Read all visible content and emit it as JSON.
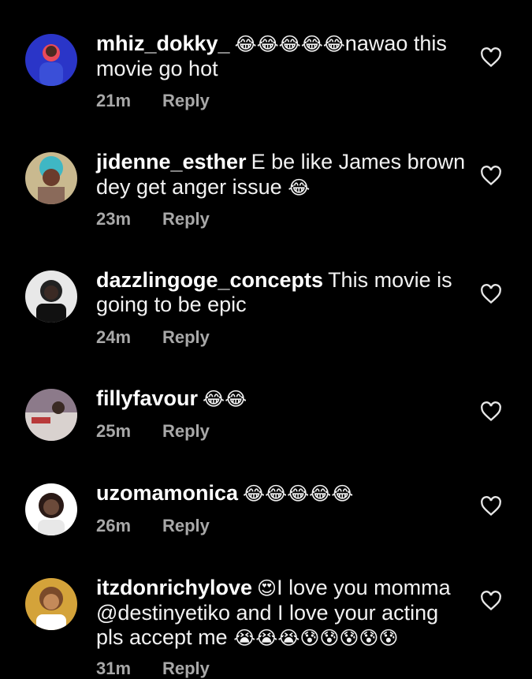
{
  "comments": [
    {
      "username": "mhiz_dokky_",
      "emoji_prefix": "😂😂😂😂😂",
      "text": "nawao this movie go hot",
      "emoji_suffix": "",
      "time": "21m",
      "reply": "Reply",
      "avatar_colors": [
        "#2a35c8",
        "#e94a5a",
        "#3a4fd8"
      ]
    },
    {
      "username": "jidenne_esther",
      "emoji_prefix": "",
      "text": "E be like James brown dey get anger issue",
      "emoji_suffix": " 😂",
      "time": "23m",
      "reply": "Reply",
      "avatar_colors": [
        "#c9b98f",
        "#3fb7c4",
        "#6b3c2c"
      ]
    },
    {
      "username": "dazzlingoge_concepts",
      "emoji_prefix": "",
      "text": "This movie is going to be epic",
      "emoji_suffix": "",
      "time": "24m",
      "reply": "Reply",
      "avatar_colors": [
        "#e8e8e8",
        "#222222",
        "#3b2a24"
      ]
    },
    {
      "username": "fillyfavour",
      "emoji_prefix": "😂😂",
      "text": "",
      "emoji_suffix": "",
      "time": "25m",
      "reply": "Reply",
      "avatar_colors": [
        "#8c7a8a",
        "#d9d2cf",
        "#b83a3a"
      ]
    },
    {
      "username": "uzomamonica",
      "emoji_prefix": "😂😂😂😂😂",
      "text": "",
      "emoji_suffix": "",
      "time": "26m",
      "reply": "Reply",
      "avatar_colors": [
        "#ffffff",
        "#2a1a16",
        "#6b4a3a"
      ]
    },
    {
      "username": "itzdonrichylove",
      "emoji_prefix": "😍",
      "text": "I love you momma @destinyetiko and I love your acting pls accept me",
      "emoji_suffix": " 😭😭😭😰😰😰😰😰",
      "time": "31m",
      "reply": "Reply",
      "avatar_colors": [
        "#d4a33a",
        "#ffffff",
        "#7a4a2a"
      ]
    }
  ]
}
